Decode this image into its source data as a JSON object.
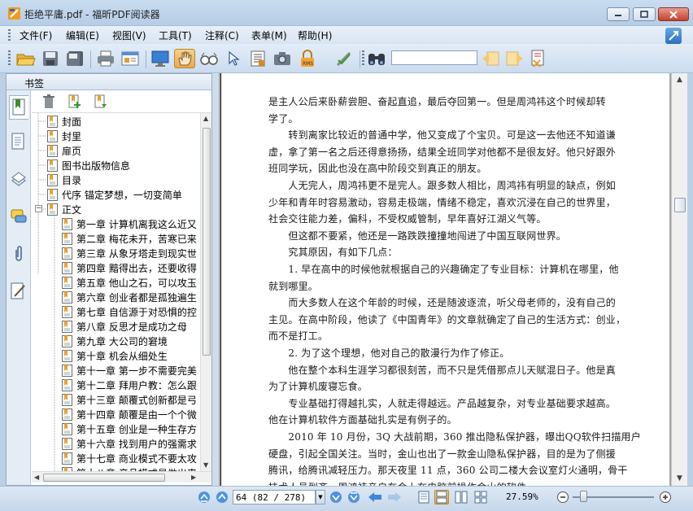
{
  "window": {
    "title": "拒绝平庸.pdf - 福昕PDF阅读器"
  },
  "menu": {
    "items": [
      "文件(F)",
      "编辑(E)",
      "视图(V)",
      "工具(T)",
      "注释(C)",
      "表单(M)",
      "帮助(H)"
    ]
  },
  "toolbar": {
    "search_value": "",
    "tools": [
      "open-folder-icon",
      "save-icon",
      "save-as-icon",
      "print-icon",
      "properties-icon",
      "fullscreen-icon",
      "hand-tool-icon",
      "loupe-icon",
      "select-arrow-icon",
      "text-select-icon",
      "snapshot-icon",
      "secure-rms-icon",
      "sign-icon",
      "find-binoculars-icon",
      "find-prev-icon",
      "find-next-icon",
      "search-options-icon"
    ],
    "active_tool": "hand-tool-icon"
  },
  "sidebar": {
    "header": "书签",
    "tabs": [
      "bookmarks-tab-icon",
      "pages-tab-icon",
      "layers-tab-icon",
      "comments-tab-icon",
      "attachments-tab-icon",
      "signatures-tab-icon"
    ],
    "bookmarks": [
      {
        "label": "封面",
        "level": 0
      },
      {
        "label": "封里",
        "level": 0
      },
      {
        "label": "扉页",
        "level": 0
      },
      {
        "label": "图书出版物信息",
        "level": 0
      },
      {
        "label": "目录",
        "level": 0
      },
      {
        "label": "代序 锚定梦想，一切变简单",
        "level": 0
      },
      {
        "label": "正文",
        "level": 0,
        "expanded": true
      },
      {
        "label": "第一章 计算机离我这么近又",
        "level": 1
      },
      {
        "label": "第二章 梅花未开，苦寒已来",
        "level": 1
      },
      {
        "label": "第三章 从象牙塔走到现实世",
        "level": 1
      },
      {
        "label": "第四章 黯得出去，还要收得",
        "level": 1
      },
      {
        "label": "第五章 他山之石，可以攻玉",
        "level": 1
      },
      {
        "label": "第六章 创业者都是孤独遍生",
        "level": 1
      },
      {
        "label": "第七章 自信源于对恐惧的控",
        "level": 1
      },
      {
        "label": "第八章 反思才是成功之母",
        "level": 1
      },
      {
        "label": "第九章 大公司的窘境",
        "level": 1
      },
      {
        "label": "第十章 机会从细处生",
        "level": 1
      },
      {
        "label": "第十一章 第一步不需要完美",
        "level": 1
      },
      {
        "label": "第十二章 拜用户教：怎么跟",
        "level": 1
      },
      {
        "label": "第十三章 颠覆式创新都是弓",
        "level": 1
      },
      {
        "label": "第十四章 颠覆是由一个个微",
        "level": 1
      },
      {
        "label": "第十五章 创业是一种生存方",
        "level": 1
      },
      {
        "label": "第十六章 找到用户的强需求",
        "level": 1
      },
      {
        "label": "第十七章 商业模式不要太攻",
        "level": 1
      },
      {
        "label": "第十八章 产品模式是做出来",
        "level": 1
      }
    ]
  },
  "document": {
    "lines": [
      "是主人公后来卧薪尝胆、奋起直追，最后夺回第一。但是周鸿祎这个时候却转",
      "学了。",
      "　　转到离家比较近的普通中学，他又变成了个宝贝。可是这一去他还不知道谦",
      "虚，拿了第一名之后还得意扬扬，结果全班同学对他都不是很友好。他只好跟外",
      "班同学玩，因此也没在高中阶段交到真正的朋友。",
      "　　人无完人，周鸿祎更不是完人。跟多数人相比，周鸿祎有明显的缺点，例如",
      "少年和青年时容易激动，容易走极端，情绪不稳定，喜欢沉浸在自己的世界里，",
      "社会交往能力差，偏科，不受权威管制，早年喜好江湖义气等。",
      "　　但这都不要紧，他还是一路跌跌撞撞地闯进了中国互联网世界。",
      "　　究其原因，有如下几点：",
      "　　1. 早在高中的时候他就根据自己的兴趣确定了专业目标：计算机在哪里，他",
      "就到哪里。",
      "　　而大多数人在这个年龄的时候，还是随波逐流，听父母老师的，没有自己的",
      "主见。在高中阶段，他读了《中国青年》的文章就确定了自己的生活方式：创业，",
      "而不是打工。",
      "　　2. 为了这个理想，他对自己的散漫行为作了修正。",
      "　　他在整个本科生涯学习都很刻苦，而不只是凭借那点儿天赋混日子。他是真",
      "为了计算机废寝忘食。",
      "　　专业基础打得越扎实，人就走得越远。产品越复杂，对专业基础要求越高。",
      "他在计算机软件方面基础扎实是有例子的。",
      "　　2010 年 10 月份，3Q 大战前期，360 推出隐私保护器，曝出QQ软件扫描用户",
      "硬盘，引起全国关注。当时，金山也出了一款金山隐私保护器，目的是为了侧援",
      "腾讯，给腾讯减轻压力。那天夜里 11 点，360 公司二楼大会议室灯火通明，骨干",
      "技术人员到齐，周鸿祎亲自在会上在电脑前操作金山的软件"
    ]
  },
  "statusbar": {
    "page_field": "64 (82 / 278)",
    "zoom": "27.59%",
    "zoom_level_fraction": 0.13
  }
}
